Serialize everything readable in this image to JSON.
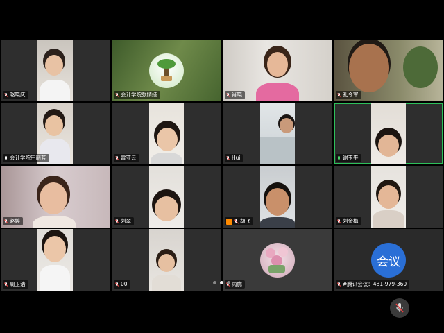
{
  "participants": [
    {
      "name": "赵晓庆",
      "muted": true
    },
    {
      "name": "会计学院张婧娅",
      "muted": true
    },
    {
      "name": "肖晓",
      "muted": true
    },
    {
      "name": "孔令军",
      "muted": true
    },
    {
      "name": "会计学院田丽芳",
      "muted": false
    },
    {
      "name": "雷亚云",
      "muted": true
    },
    {
      "name": "Hui",
      "muted": true
    },
    {
      "name": "谢玉平",
      "muted": false,
      "speaking": true
    },
    {
      "name": "赵婷",
      "muted": true
    },
    {
      "name": "刘翠",
      "muted": true
    },
    {
      "name": "胡飞",
      "muted": true
    },
    {
      "name": "刘金梅",
      "muted": true
    },
    {
      "name": "周玉浩",
      "muted": true
    },
    {
      "name": "00",
      "muted": true
    },
    {
      "name": "雨脆",
      "muted": true
    },
    {
      "name": "#腾讯会议：481-979-360",
      "muted": true
    }
  ],
  "meeting_logo_text": "会议",
  "colors": {
    "active_border": "#2ec05b",
    "tile_bg": "#2e2e2e",
    "logo_blue": "#2a6fd6"
  },
  "pager": {
    "pages": 3,
    "current": 2
  }
}
